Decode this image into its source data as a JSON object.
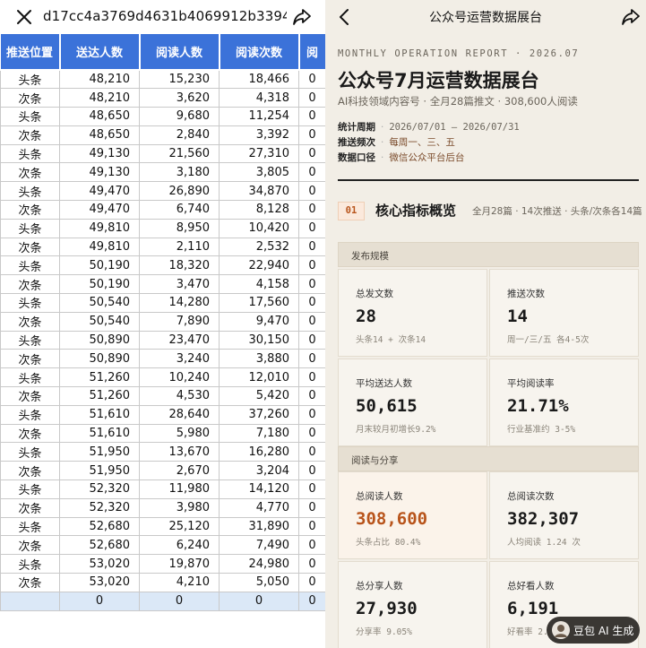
{
  "left": {
    "title": "d17cc4a3769d4631b4069912b3394...",
    "columns": [
      "推送位置",
      "送达人数",
      "阅读人数",
      "阅读次数",
      "阅"
    ],
    "rows": [
      [
        "头条",
        "48,210",
        "15,230",
        "18,466",
        "0"
      ],
      [
        "次条",
        "48,210",
        "3,620",
        "4,318",
        "0"
      ],
      [
        "头条",
        "48,650",
        "9,680",
        "11,254",
        "0"
      ],
      [
        "次条",
        "48,650",
        "2,840",
        "3,392",
        "0"
      ],
      [
        "头条",
        "49,130",
        "21,560",
        "27,310",
        "0"
      ],
      [
        "次条",
        "49,130",
        "3,180",
        "3,805",
        "0"
      ],
      [
        "头条",
        "49,470",
        "26,890",
        "34,870",
        "0"
      ],
      [
        "次条",
        "49,470",
        "6,740",
        "8,128",
        "0"
      ],
      [
        "头条",
        "49,810",
        "8,950",
        "10,420",
        "0"
      ],
      [
        "次条",
        "49,810",
        "2,110",
        "2,532",
        "0"
      ],
      [
        "头条",
        "50,190",
        "18,320",
        "22,940",
        "0"
      ],
      [
        "次条",
        "50,190",
        "3,470",
        "4,158",
        "0"
      ],
      [
        "头条",
        "50,540",
        "14,280",
        "17,560",
        "0"
      ],
      [
        "次条",
        "50,540",
        "7,890",
        "9,470",
        "0"
      ],
      [
        "头条",
        "50,890",
        "23,470",
        "30,150",
        "0"
      ],
      [
        "次条",
        "50,890",
        "3,240",
        "3,880",
        "0"
      ],
      [
        "头条",
        "51,260",
        "10,240",
        "12,010",
        "0"
      ],
      [
        "次条",
        "51,260",
        "4,530",
        "5,420",
        "0"
      ],
      [
        "头条",
        "51,610",
        "28,640",
        "37,260",
        "0"
      ],
      [
        "次条",
        "51,610",
        "5,980",
        "7,180",
        "0"
      ],
      [
        "头条",
        "51,950",
        "13,670",
        "16,280",
        "0"
      ],
      [
        "次条",
        "51,950",
        "2,670",
        "3,204",
        "0"
      ],
      [
        "头条",
        "52,320",
        "11,980",
        "14,120",
        "0"
      ],
      [
        "次条",
        "52,320",
        "3,980",
        "4,770",
        "0"
      ],
      [
        "头条",
        "52,680",
        "25,120",
        "31,890",
        "0"
      ],
      [
        "次条",
        "52,680",
        "6,240",
        "7,490",
        "0"
      ],
      [
        "头条",
        "53,020",
        "19,870",
        "24,980",
        "0"
      ],
      [
        "次条",
        "53,020",
        "4,210",
        "5,050",
        "0"
      ]
    ],
    "total_row": [
      "",
      "0",
      "0",
      "0",
      "0"
    ]
  },
  "right": {
    "title": "公众号运营数据展台",
    "report": {
      "eyebrow": "MONTHLY OPERATION REPORT · 2026.07",
      "title": "公众号7月运营数据展台",
      "subtitle": "AI科技领域内容号 · 全月28篇推文 · 308,600人阅读",
      "meta": [
        {
          "label": "统计周期",
          "value": "2026/07/01 — 2026/07/31"
        },
        {
          "label": "推送频次",
          "value": "每周一、三、五"
        },
        {
          "label": "数据口径",
          "value": "微信公众平台后台"
        }
      ],
      "section": {
        "num": "01",
        "title": "核心指标概览",
        "note": "全月28篇 · 14次推送 · 头条/次条各14篇"
      },
      "groups": [
        "发布规模",
        "阅读与分享"
      ],
      "cards": [
        {
          "label": "总发文数",
          "value": "28",
          "sub": "头条14 + 次条14"
        },
        {
          "label": "推送次数",
          "value": "14",
          "sub": "周一/三/五 各4-5次"
        },
        {
          "label": "平均送达人数",
          "value": "50,615",
          "sub": "月末较月初增长9.2%"
        },
        {
          "label": "平均阅读率",
          "value": "21.71%",
          "sub": "行业基准约 3-5%"
        },
        {
          "label": "总阅读人数",
          "value": "308,600",
          "sub": "头条占比 80.4%"
        },
        {
          "label": "总阅读次数",
          "value": "382,307",
          "sub": "人均阅读 1.24 次"
        },
        {
          "label": "总分享人数",
          "value": "27,930",
          "sub": "分享率 9.05%"
        },
        {
          "label": "总好看人数",
          "value": "6,191",
          "sub": "好看率 2."
        }
      ]
    },
    "ai_badge": "豆包 AI 生成"
  },
  "colors": {
    "header_blue": "#3b72d9",
    "accent_orange": "#b8541b",
    "panel_bg": "#f2eee6",
    "total_row_bg": "#dbe8f7"
  },
  "icons": {
    "close": "close-icon",
    "share": "share-icon",
    "back": "back-icon"
  }
}
